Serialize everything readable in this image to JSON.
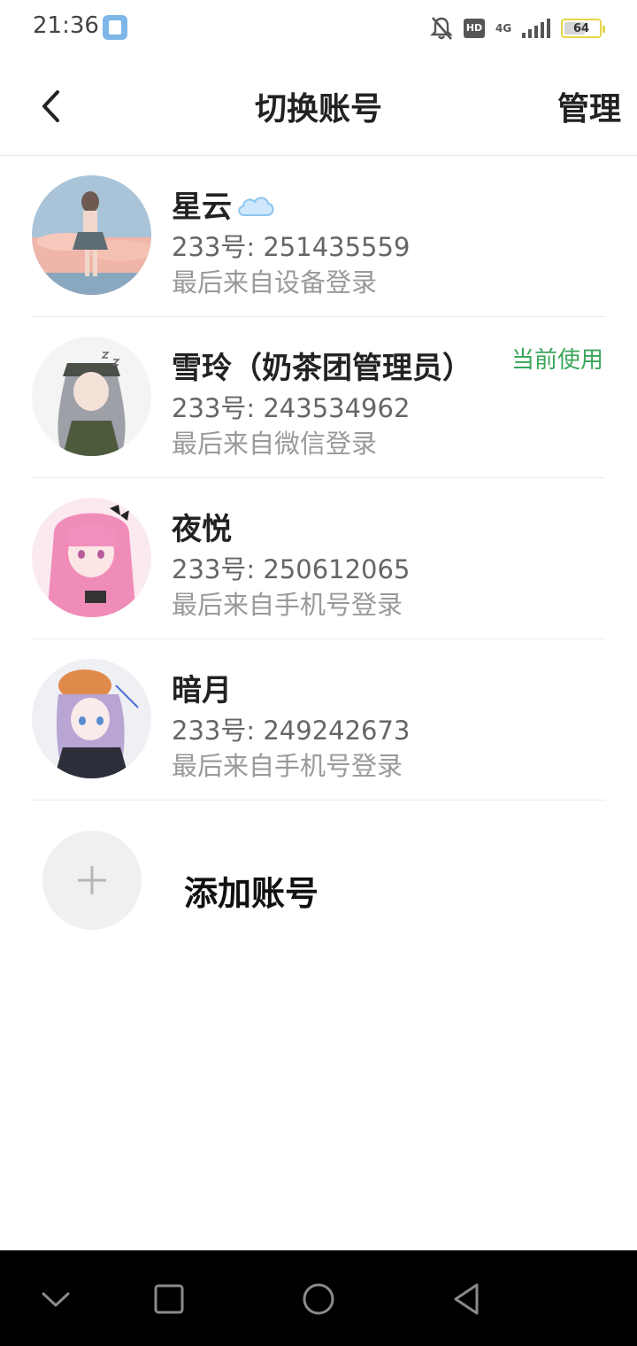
{
  "status_bar": {
    "time": "21:36",
    "hd_badge": "HD",
    "network": "4G",
    "battery": "64",
    "battery_level": 0.64
  },
  "nav": {
    "back_icon": "chevron-left-icon",
    "title": "切换账号",
    "manage_label": "管理"
  },
  "accounts": [
    {
      "name": "星云",
      "name_emoji": "cloud-icon",
      "id_text": "233号: 251435559",
      "login_text": "最后来自设备登录",
      "current_label": ""
    },
    {
      "name": "雪玲（奶茶团管理员）",
      "id_text": "233号: 243534962",
      "login_text": "最后来自微信登录",
      "current_label": "当前使用"
    },
    {
      "name": "夜悦",
      "id_text": "233号: 250612065",
      "login_text": "最后来自手机号登录",
      "current_label": ""
    },
    {
      "name": "暗月",
      "id_text": "233号: 249242673",
      "login_text": "最后来自手机号登录",
      "current_label": ""
    }
  ],
  "add_account": {
    "icon": "plus-icon",
    "label": "添加账号"
  },
  "system_nav": {
    "buttons": [
      "chevron-down-icon",
      "square-icon",
      "circle-icon",
      "triangle-back-icon"
    ]
  },
  "colors": {
    "accent_green": "#3aa65a",
    "divider": "#ececec",
    "text_primary": "#222222",
    "text_secondary": "#666666",
    "text_tertiary": "#999999"
  }
}
